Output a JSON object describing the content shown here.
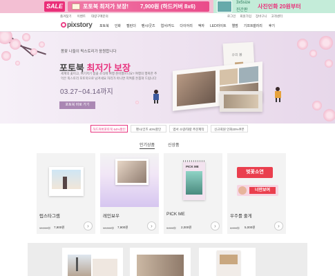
{
  "top_banner": {
    "sale_badge": "SALE",
    "promo_title": "포토북 최저가 보장!",
    "promo_price": "7,900원 (하드커버 8x6)",
    "right_small_1": "3x5size",
    "right_small_2": "진간판",
    "right_highlight": "사진인화 20원부터"
  },
  "util_links_left": [
    "즐겨찾기",
    "이벤트",
    "대량구매문의"
  ],
  "util_links_right": [
    "로그인",
    "회원가입",
    "장바구니",
    "고객센터"
  ],
  "header": {
    "logo_text": "pixstory",
    "nav": [
      "포토북",
      "인화",
      "캘린더",
      "팬시/굿즈",
      "엽서/카드",
      "다이어리",
      "액자",
      "LED라이트",
      "앨범",
      "기프트"
    ],
    "nav_right": [
      "갤러리",
      "후기"
    ]
  },
  "hero": {
    "subtitle": "봄꽃 나들이 픽스토리가 응원합니다",
    "title_prefix": "포토북",
    "title_highlight": "최저가 보장",
    "description": "세계의 꽃이고, 여기저기 봄꽃 소식에 여행 준비했으니요? 여행의 행복한 추억은 픽스토리 포토북으로 남겨세요 자리가 아니면 지켜를 돈뽑혀 드립니다",
    "date_range": "03.27~04.14까지",
    "cta_button": "포토북 바로 가기",
    "book_label": "우리 봄"
  },
  "event_tabs": [
    {
      "label": "하드커버포토북 64%할인",
      "active": true
    },
    {
      "label": "팬시/굿즈 40%할인",
      "active": false
    },
    {
      "label": "엽서 소량/대량 추문제작",
      "active": false
    },
    {
      "label": "신규회원 인화20%쿠폰",
      "active": false
    }
  ],
  "section_tabs": [
    {
      "label": "인기상품",
      "active": true
    },
    {
      "label": "신상품",
      "active": false
    }
  ],
  "products": [
    {
      "name": "럽스타그램",
      "old_price": "10,000원",
      "new_price": "7,900원"
    },
    {
      "name": "레인보우",
      "old_price": "10,000원",
      "new_price": "7,900원"
    },
    {
      "name": "PICK ME",
      "old_price": "3,000원",
      "new_price": "2,000원",
      "cover_text": "PICK ME"
    },
    {
      "name": "우주를 줄게",
      "old_price": "6,000원",
      "new_price": "5,000원",
      "label_1": "벚꽃소연",
      "label_2": "너만보여"
    }
  ],
  "arrow_glyph": "›",
  "colors": {
    "accent_pink": "#e8337e",
    "hero_button": "#aa87b3",
    "top_strip": "#f3bfd3"
  }
}
